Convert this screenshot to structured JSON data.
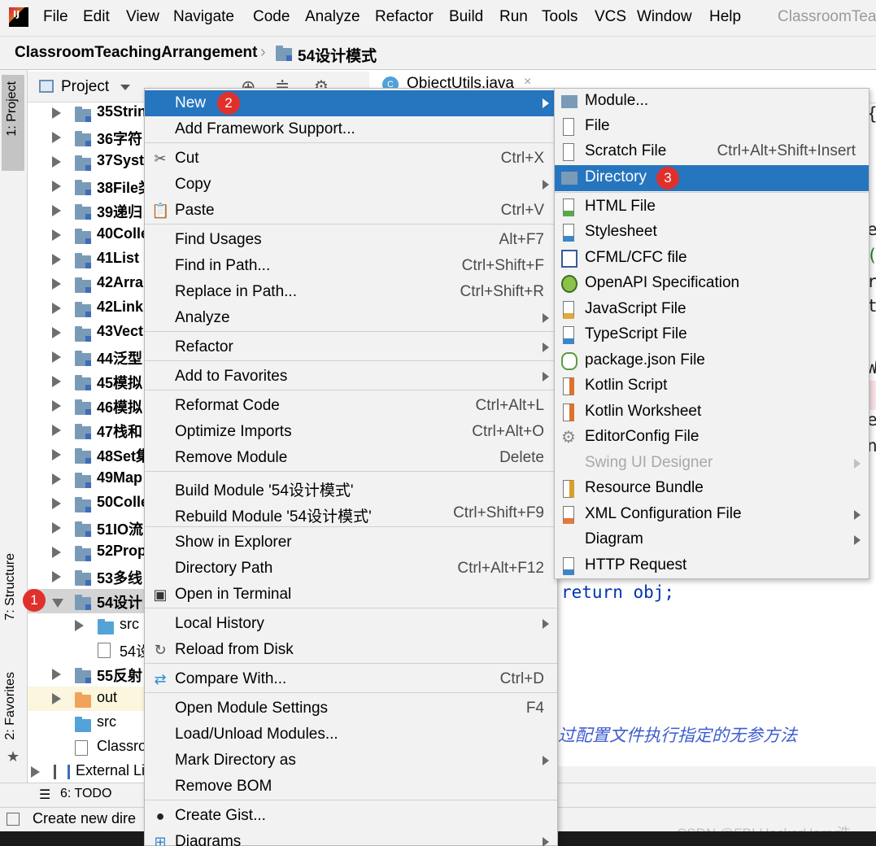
{
  "colors": {
    "highlight": "#2675bf",
    "badge": "#e0302b",
    "folder": "#7a9bb8",
    "src_folder": "#54a3d8",
    "out_folder": "#f0a35a"
  },
  "menubar": {
    "items": [
      "File",
      "Edit",
      "View",
      "Navigate",
      "Code",
      "Analyze",
      "Refactor",
      "Build",
      "Run",
      "Tools",
      "VCS",
      "Window",
      "Help"
    ],
    "title": "ClassroomTeac"
  },
  "breadcrumb": {
    "project": "ClassroomTeachingArrangement",
    "module": "54设计模式"
  },
  "left_stripe": {
    "project": "1: Project",
    "structure": "7: Structure",
    "favorites": "2: Favorites"
  },
  "project_panel": {
    "title": "Project",
    "tree": [
      "35Strin",
      "36字符",
      "37Syst",
      "38File类",
      "39递归",
      "40Colle",
      "41List",
      "42Arra",
      "42Link",
      "43Vect",
      "44泛型",
      "45模拟",
      "46模拟",
      "47栈和",
      "48Set集",
      "49Map",
      "50Colle",
      "51IO流",
      "52Prop",
      "53多线",
      "54设计",
      "src",
      "54设",
      "55反射",
      "out",
      "src",
      "Classro",
      "External Li"
    ]
  },
  "editor": {
    "tab": "ObjectUtils.java",
    "code_line": "return obj;",
    "comment": "过配置文件执行指定的无参方法",
    "right_chars": [
      "{",
      "e",
      "(",
      "r",
      "t",
      "W",
      "s",
      "e",
      "n"
    ]
  },
  "context_menu": [
    {
      "label": "New",
      "shortcut": "",
      "submenu": true,
      "icon": ""
    },
    {
      "label": "Add Framework Support...",
      "shortcut": "",
      "submenu": false,
      "icon": ""
    },
    {
      "label": "Cut",
      "shortcut": "Ctrl+X",
      "submenu": false,
      "icon": "scissors-icon"
    },
    {
      "label": "Copy",
      "shortcut": "",
      "submenu": true,
      "icon": ""
    },
    {
      "label": "Paste",
      "shortcut": "Ctrl+V",
      "submenu": false,
      "icon": "clipboard-icon"
    },
    {
      "label": "Find Usages",
      "shortcut": "Alt+F7",
      "submenu": false,
      "icon": ""
    },
    {
      "label": "Find in Path...",
      "shortcut": "Ctrl+Shift+F",
      "submenu": false,
      "icon": ""
    },
    {
      "label": "Replace in Path...",
      "shortcut": "Ctrl+Shift+R",
      "submenu": false,
      "icon": ""
    },
    {
      "label": "Analyze",
      "shortcut": "",
      "submenu": true,
      "icon": ""
    },
    {
      "label": "Refactor",
      "shortcut": "",
      "submenu": true,
      "icon": ""
    },
    {
      "label": "Add to Favorites",
      "shortcut": "",
      "submenu": true,
      "icon": ""
    },
    {
      "label": "Reformat Code",
      "shortcut": "Ctrl+Alt+L",
      "submenu": false,
      "icon": ""
    },
    {
      "label": "Optimize Imports",
      "shortcut": "Ctrl+Alt+O",
      "submenu": false,
      "icon": ""
    },
    {
      "label": "Remove Module",
      "shortcut": "Delete",
      "submenu": false,
      "icon": ""
    },
    {
      "label": "Build Module '54设计模式'",
      "shortcut": "",
      "submenu": false,
      "icon": ""
    },
    {
      "label": "Rebuild Module '54设计模式'",
      "shortcut": "Ctrl+Shift+F9",
      "submenu": false,
      "icon": ""
    },
    {
      "label": "Show in Explorer",
      "shortcut": "",
      "submenu": false,
      "icon": ""
    },
    {
      "label": "Directory Path",
      "shortcut": "Ctrl+Alt+F12",
      "submenu": false,
      "icon": ""
    },
    {
      "label": "Open in Terminal",
      "shortcut": "",
      "submenu": false,
      "icon": "terminal-icon"
    },
    {
      "label": "Local History",
      "shortcut": "",
      "submenu": true,
      "icon": ""
    },
    {
      "label": "Reload from Disk",
      "shortcut": "",
      "submenu": false,
      "icon": "reload-icon"
    },
    {
      "label": "Compare With...",
      "shortcut": "Ctrl+D",
      "submenu": false,
      "icon": "compare-icon"
    },
    {
      "label": "Open Module Settings",
      "shortcut": "F4",
      "submenu": false,
      "icon": ""
    },
    {
      "label": "Load/Unload Modules...",
      "shortcut": "",
      "submenu": false,
      "icon": ""
    },
    {
      "label": "Mark Directory as",
      "shortcut": "",
      "submenu": true,
      "icon": ""
    },
    {
      "label": "Remove BOM",
      "shortcut": "",
      "submenu": false,
      "icon": ""
    },
    {
      "label": "Create Gist...",
      "shortcut": "",
      "submenu": false,
      "icon": "github-icon"
    },
    {
      "label": "Diagrams",
      "shortcut": "",
      "submenu": true,
      "icon": "diagrams-icon"
    }
  ],
  "new_submenu": [
    {
      "label": "Module...",
      "shortcut": "",
      "submenu": false,
      "icon": "module-icon"
    },
    {
      "label": "File",
      "shortcut": "",
      "submenu": false,
      "icon": "file-icon"
    },
    {
      "label": "Scratch File",
      "shortcut": "Ctrl+Alt+Shift+Insert",
      "submenu": false,
      "icon": "scratch-file-icon"
    },
    {
      "label": "Directory",
      "shortcut": "",
      "submenu": false,
      "icon": "folder-icon"
    },
    {
      "label": "HTML File",
      "shortcut": "",
      "submenu": false,
      "icon": "html-file-icon"
    },
    {
      "label": "Stylesheet",
      "shortcut": "",
      "submenu": false,
      "icon": "css-file-icon"
    },
    {
      "label": "CFML/CFC file",
      "shortcut": "",
      "submenu": false,
      "icon": "cfml-file-icon"
    },
    {
      "label": "OpenAPI Specification",
      "shortcut": "",
      "submenu": false,
      "icon": "openapi-icon"
    },
    {
      "label": "JavaScript File",
      "shortcut": "",
      "submenu": false,
      "icon": "javascript-file-icon"
    },
    {
      "label": "TypeScript File",
      "shortcut": "",
      "submenu": false,
      "icon": "typescript-file-icon"
    },
    {
      "label": "package.json File",
      "shortcut": "",
      "submenu": false,
      "icon": "nodejs-icon"
    },
    {
      "label": "Kotlin Script",
      "shortcut": "",
      "submenu": false,
      "icon": "kotlin-icon"
    },
    {
      "label": "Kotlin Worksheet",
      "shortcut": "",
      "submenu": false,
      "icon": "kotlin-icon"
    },
    {
      "label": "EditorConfig File",
      "shortcut": "",
      "submenu": false,
      "icon": "gear-icon"
    },
    {
      "label": "Swing UI Designer",
      "shortcut": "",
      "submenu": true,
      "icon": ""
    },
    {
      "label": "Resource Bundle",
      "shortcut": "",
      "submenu": false,
      "icon": "resource-bundle-icon"
    },
    {
      "label": "XML Configuration File",
      "shortcut": "",
      "submenu": true,
      "icon": "xml-file-icon"
    },
    {
      "label": "Diagram",
      "shortcut": "",
      "submenu": true,
      "icon": ""
    },
    {
      "label": "HTTP Request",
      "shortcut": "",
      "submenu": false,
      "icon": "api-icon"
    }
  ],
  "badges": [
    "1",
    "2",
    "3"
  ],
  "bottom": {
    "todo": "6: TODO",
    "status": "Create new dire",
    "watermark": "CSDN @FBI HackerHarry浩"
  }
}
